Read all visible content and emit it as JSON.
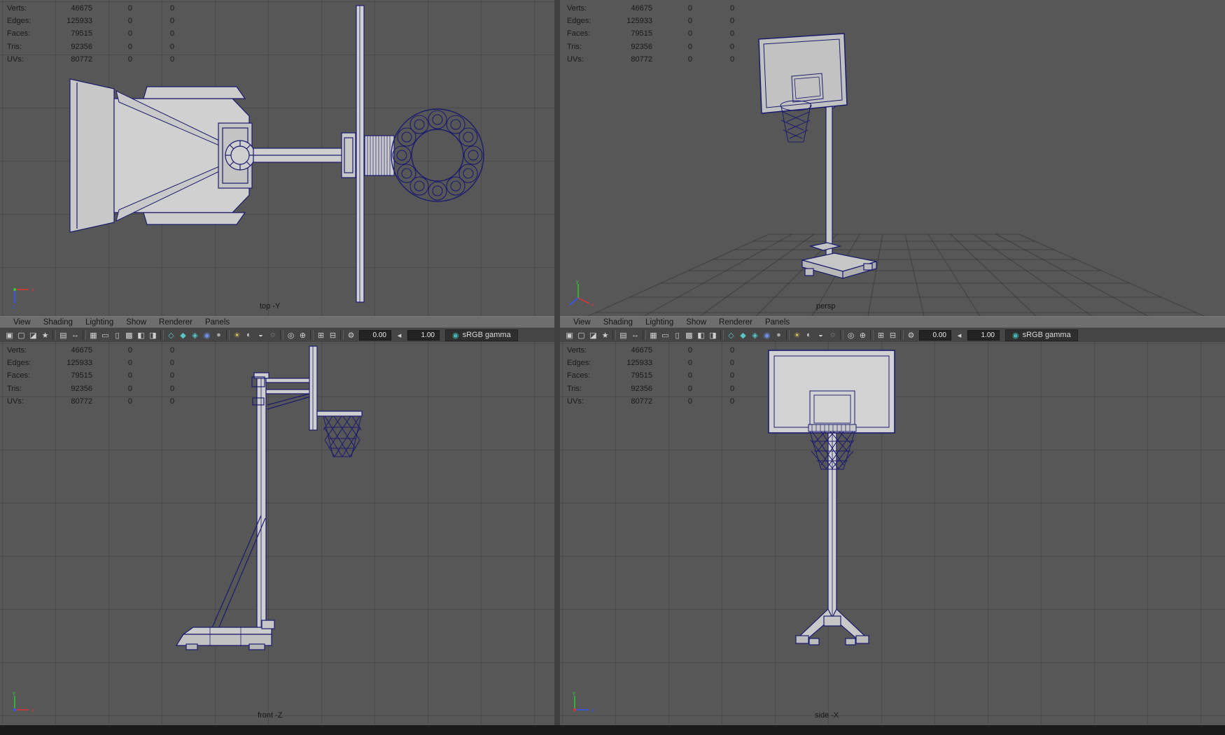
{
  "colors": {
    "viewport_bg": "#575757",
    "grid_line": "#4d4d4d",
    "wireframe": "#1b1b6e",
    "surface_fill": "#cccccc",
    "hud_text": "#191919",
    "menu_bg": "#6e6e6e",
    "toolbar_bg": "#454545",
    "accent_teal": "#49b8b8",
    "accent_yellow": "#e3c95c",
    "accent_blue": "#6f8fe8",
    "axis_x": "#e03333",
    "axis_y": "#2ecc2e",
    "axis_z": "#3355ff"
  },
  "hud": {
    "rows": [
      {
        "label": "Verts:",
        "value": "46675",
        "col2": "0",
        "col3": "0"
      },
      {
        "label": "Edges:",
        "value": "125933",
        "col2": "0",
        "col3": "0"
      },
      {
        "label": "Faces:",
        "value": "79515",
        "col2": "0",
        "col3": "0"
      },
      {
        "label": "Tris:",
        "value": "92356",
        "col2": "0",
        "col3": "0"
      },
      {
        "label": "UVs:",
        "value": "80772",
        "col2": "0",
        "col3": "0"
      }
    ]
  },
  "viewports": {
    "top": {
      "label": "top -Y"
    },
    "persp": {
      "label": "persp"
    },
    "front": {
      "label": "front -Z"
    },
    "side": {
      "label": "side -X"
    }
  },
  "panel_menu": {
    "items": [
      {
        "label": "View"
      },
      {
        "label": "Shading"
      },
      {
        "label": "Lighting"
      },
      {
        "label": "Show"
      },
      {
        "label": "Renderer"
      },
      {
        "label": "Panels"
      }
    ]
  },
  "panel_toolbar": {
    "icons": [
      {
        "name": "select-camera-icon",
        "glyph": "▣"
      },
      {
        "name": "lock-camera-icon",
        "glyph": "▢"
      },
      {
        "name": "camera-attributes-icon",
        "glyph": "◪"
      },
      {
        "name": "bookmark-icon",
        "glyph": "★"
      },
      {
        "sep": true
      },
      {
        "name": "image-plane-icon",
        "glyph": "▤"
      },
      {
        "name": "pan-zoom-icon",
        "glyph": "↔"
      },
      {
        "sep": true
      },
      {
        "name": "grid-icon",
        "glyph": "▦"
      },
      {
        "name": "film-gate-icon",
        "glyph": "▭"
      },
      {
        "name": "resolution-gate-icon",
        "glyph": "▯"
      },
      {
        "name": "gate-mask-icon",
        "glyph": "▩"
      },
      {
        "name": "safe-action-icon",
        "glyph": "◧"
      },
      {
        "name": "safe-title-icon",
        "glyph": "◨"
      },
      {
        "sep": true
      },
      {
        "name": "wireframe-mode-icon",
        "glyph": "◇",
        "color": "#58c6c6"
      },
      {
        "name": "smooth-shade-icon",
        "glyph": "◆",
        "color": "#58c6c6"
      },
      {
        "name": "textured-mode-icon",
        "glyph": "◈",
        "color": "#58c6c6"
      },
      {
        "name": "wireframe-on-shaded-icon",
        "glyph": "◉",
        "color": "#6f8fe8"
      },
      {
        "name": "default-material-icon",
        "glyph": "●",
        "color": "#a8a8a8"
      },
      {
        "sep": true
      },
      {
        "name": "use-lights-icon",
        "glyph": "☀",
        "color": "#e3c95c"
      },
      {
        "name": "shadows-icon",
        "glyph": "◐"
      },
      {
        "name": "occlusion-icon",
        "glyph": "◒"
      },
      {
        "name": "motion-blur-icon",
        "glyph": "◌"
      },
      {
        "sep": true
      },
      {
        "name": "isolate-select-icon",
        "glyph": "◎"
      },
      {
        "name": "paint-icon",
        "glyph": "⊕"
      },
      {
        "sep": true
      },
      {
        "name": "copy-view-icon",
        "glyph": "⊞"
      },
      {
        "name": "paste-view-icon",
        "glyph": "⊟"
      },
      {
        "sep": true
      }
    ],
    "exposure_icon": {
      "name": "exposure-gear-icon",
      "glyph": "⚙"
    },
    "exposure_value": "0.00",
    "gamma_toggle_icon": {
      "name": "gamma-toggle-icon",
      "glyph": "◂"
    },
    "gamma_value": "1.00",
    "colorspace_icon": {
      "name": "colorspace-icon",
      "glyph": "◉"
    },
    "colorspace_label": "sRGB gamma"
  }
}
